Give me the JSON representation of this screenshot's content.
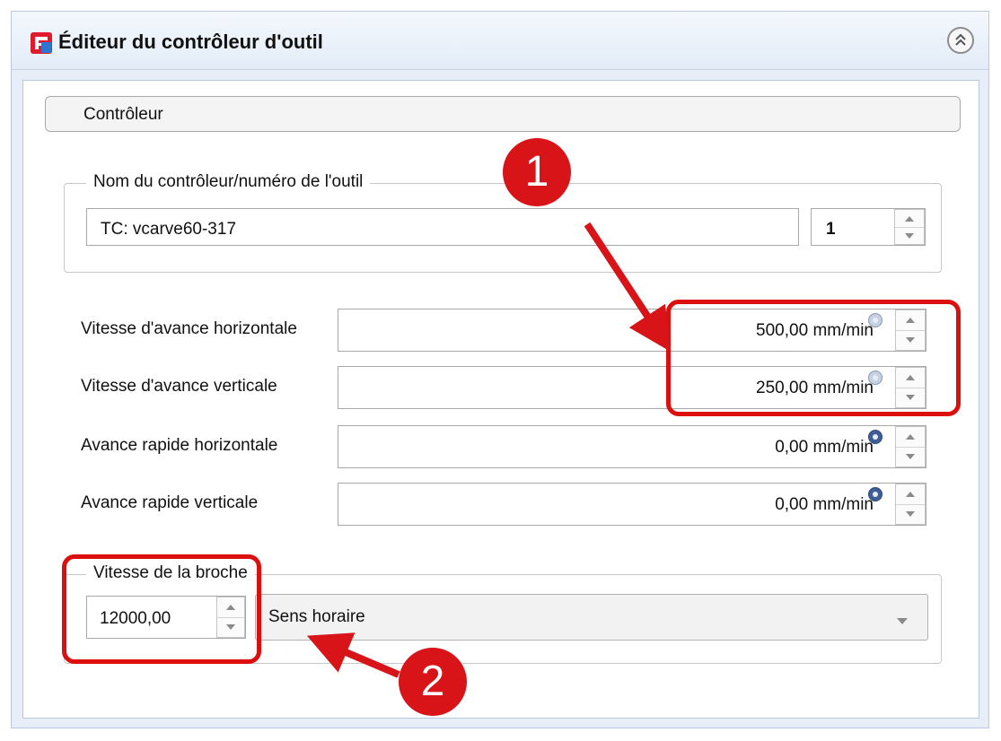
{
  "window": {
    "title": "Éditeur du contrôleur d'outil",
    "collapse_icon": "double-chevron-up-icon"
  },
  "section": {
    "label": "Contrôleur"
  },
  "tool_group": {
    "legend": "Nom du contrôleur/numéro de l'outil",
    "name_value": "TC: vcarve60-317",
    "number_value": "1"
  },
  "feeds": [
    {
      "label": "Vitesse d'avance horizontale",
      "value": "500,00 mm/min",
      "badge": "link-icon"
    },
    {
      "label": "Vitesse d'avance verticale",
      "value": "250,00 mm/min",
      "badge": "link-icon"
    },
    {
      "label": "Avance rapide horizontale",
      "value": "0,00 mm/min",
      "badge": "link-icon"
    },
    {
      "label": "Avance rapide verticale",
      "value": "0,00 mm/min",
      "badge": "link-icon"
    }
  ],
  "spindle": {
    "legend": "Vitesse de la broche",
    "speed_value": "12000,00",
    "direction_value": "Sens horaire"
  },
  "annotations": {
    "step1": "1",
    "step2": "2",
    "color": "#d81419"
  },
  "colors": {
    "accent_blue": "#e7eef8",
    "border": "#b9c9de"
  }
}
